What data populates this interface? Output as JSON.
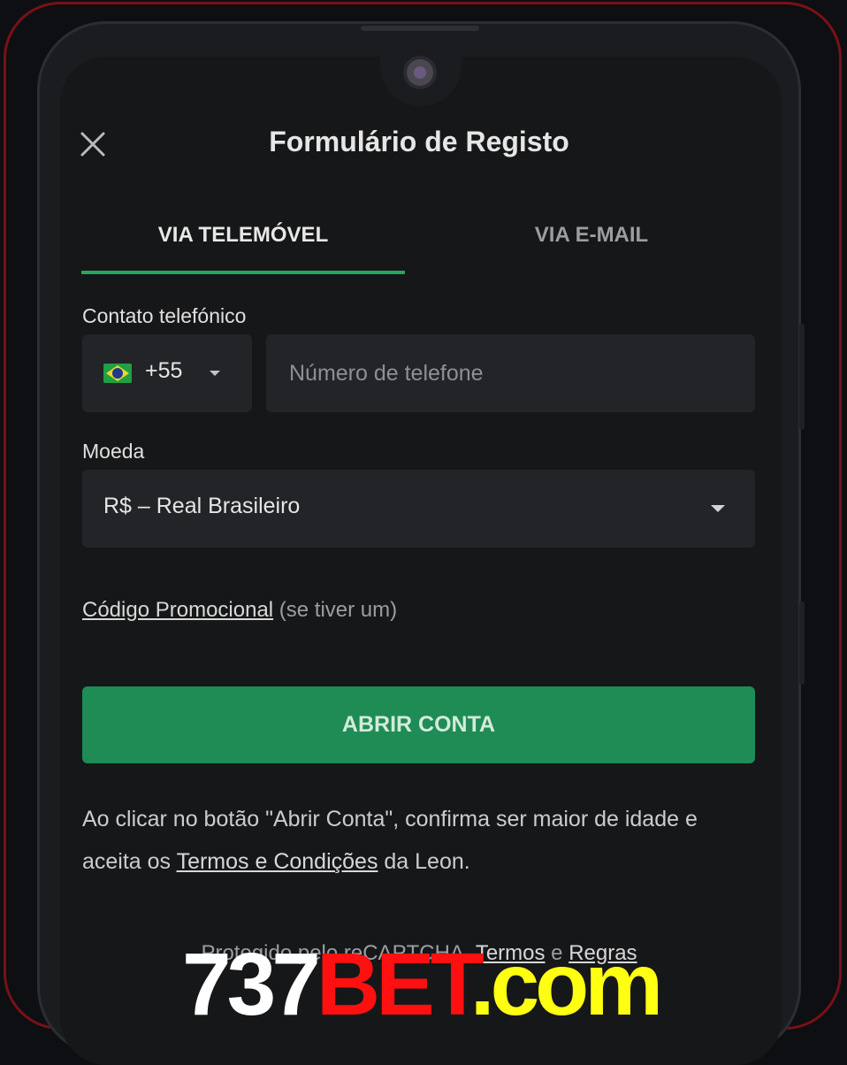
{
  "colors": {
    "accent_green": "#25a661",
    "button_green": "#1e8c54",
    "screen_bg": "#161718",
    "field_bg": "#222427",
    "frame_red": "#7a1018",
    "watermark_white": "#ffffff",
    "watermark_red": "#ff1010",
    "watermark_yellow": "#ffff12"
  },
  "header": {
    "title": "Formulário de Registo",
    "close_icon": "close-icon"
  },
  "tabs": [
    {
      "label": "VIA TELEMÓVEL",
      "active": true
    },
    {
      "label": "VIA E-MAIL",
      "active": false
    }
  ],
  "phone": {
    "label": "Contato telefónico",
    "country_flag": "brazil-flag-icon",
    "country_code": "+55",
    "placeholder": "Número de telefone",
    "value": ""
  },
  "currency": {
    "label": "Moeda",
    "selected": "R$ – Real Brasileiro"
  },
  "promo": {
    "link": "Código Promocional",
    "suffix": " (se tiver um)"
  },
  "submit": {
    "label": "ABRIR CONTA"
  },
  "disclaimer": {
    "before": "Ao clicar no botão \"Abrir Conta\", confirma ser maior de idade e aceita os ",
    "link": "Termos e Condições",
    "after": " da Leon."
  },
  "footer": {
    "text": "Protegido pelo reCAPTCHA.",
    "link1": "Termos",
    "conj": " e ",
    "link2": "Regras"
  },
  "watermark": {
    "part1": "737",
    "part2": "BET",
    "part3": ".com"
  }
}
